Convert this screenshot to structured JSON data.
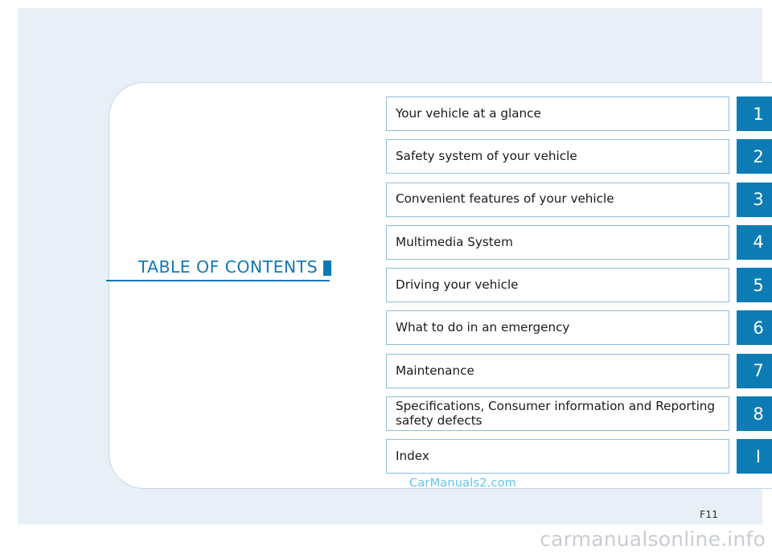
{
  "document": {
    "title": "TABLE OF CONTENTS",
    "page_number": "F11"
  },
  "toc": {
    "heading": "TABLE OF CONTENTS",
    "rows": [
      {
        "label": "Your vehicle at a glance",
        "number": "1"
      },
      {
        "label": "Safety system of your vehicle",
        "number": "2"
      },
      {
        "label": "Convenient features of your vehicle",
        "number": "3"
      },
      {
        "label": "Multimedia System",
        "number": "4"
      },
      {
        "label": "Driving your vehicle",
        "number": "5"
      },
      {
        "label": "What to do in an emergency",
        "number": "6"
      },
      {
        "label": "Maintenance",
        "number": "7"
      },
      {
        "label": "Specifications, Consumer information and Reporting safety defects",
        "number": "8"
      },
      {
        "label": "Index",
        "number": "I"
      }
    ]
  },
  "watermark": {
    "text": "CarManuals2.com"
  },
  "site_bar": {
    "text": "carmanualsonline.info"
  },
  "colors": {
    "accent_blue": "#0d7cb5",
    "title_blue": "#1277b8",
    "row_border": "#8fbedd",
    "card_border": "#c3d8ea",
    "page_background": "#e9eff6",
    "watermark_blue": "#62c4f0",
    "site_bar_gray": "#c9cdd2"
  }
}
